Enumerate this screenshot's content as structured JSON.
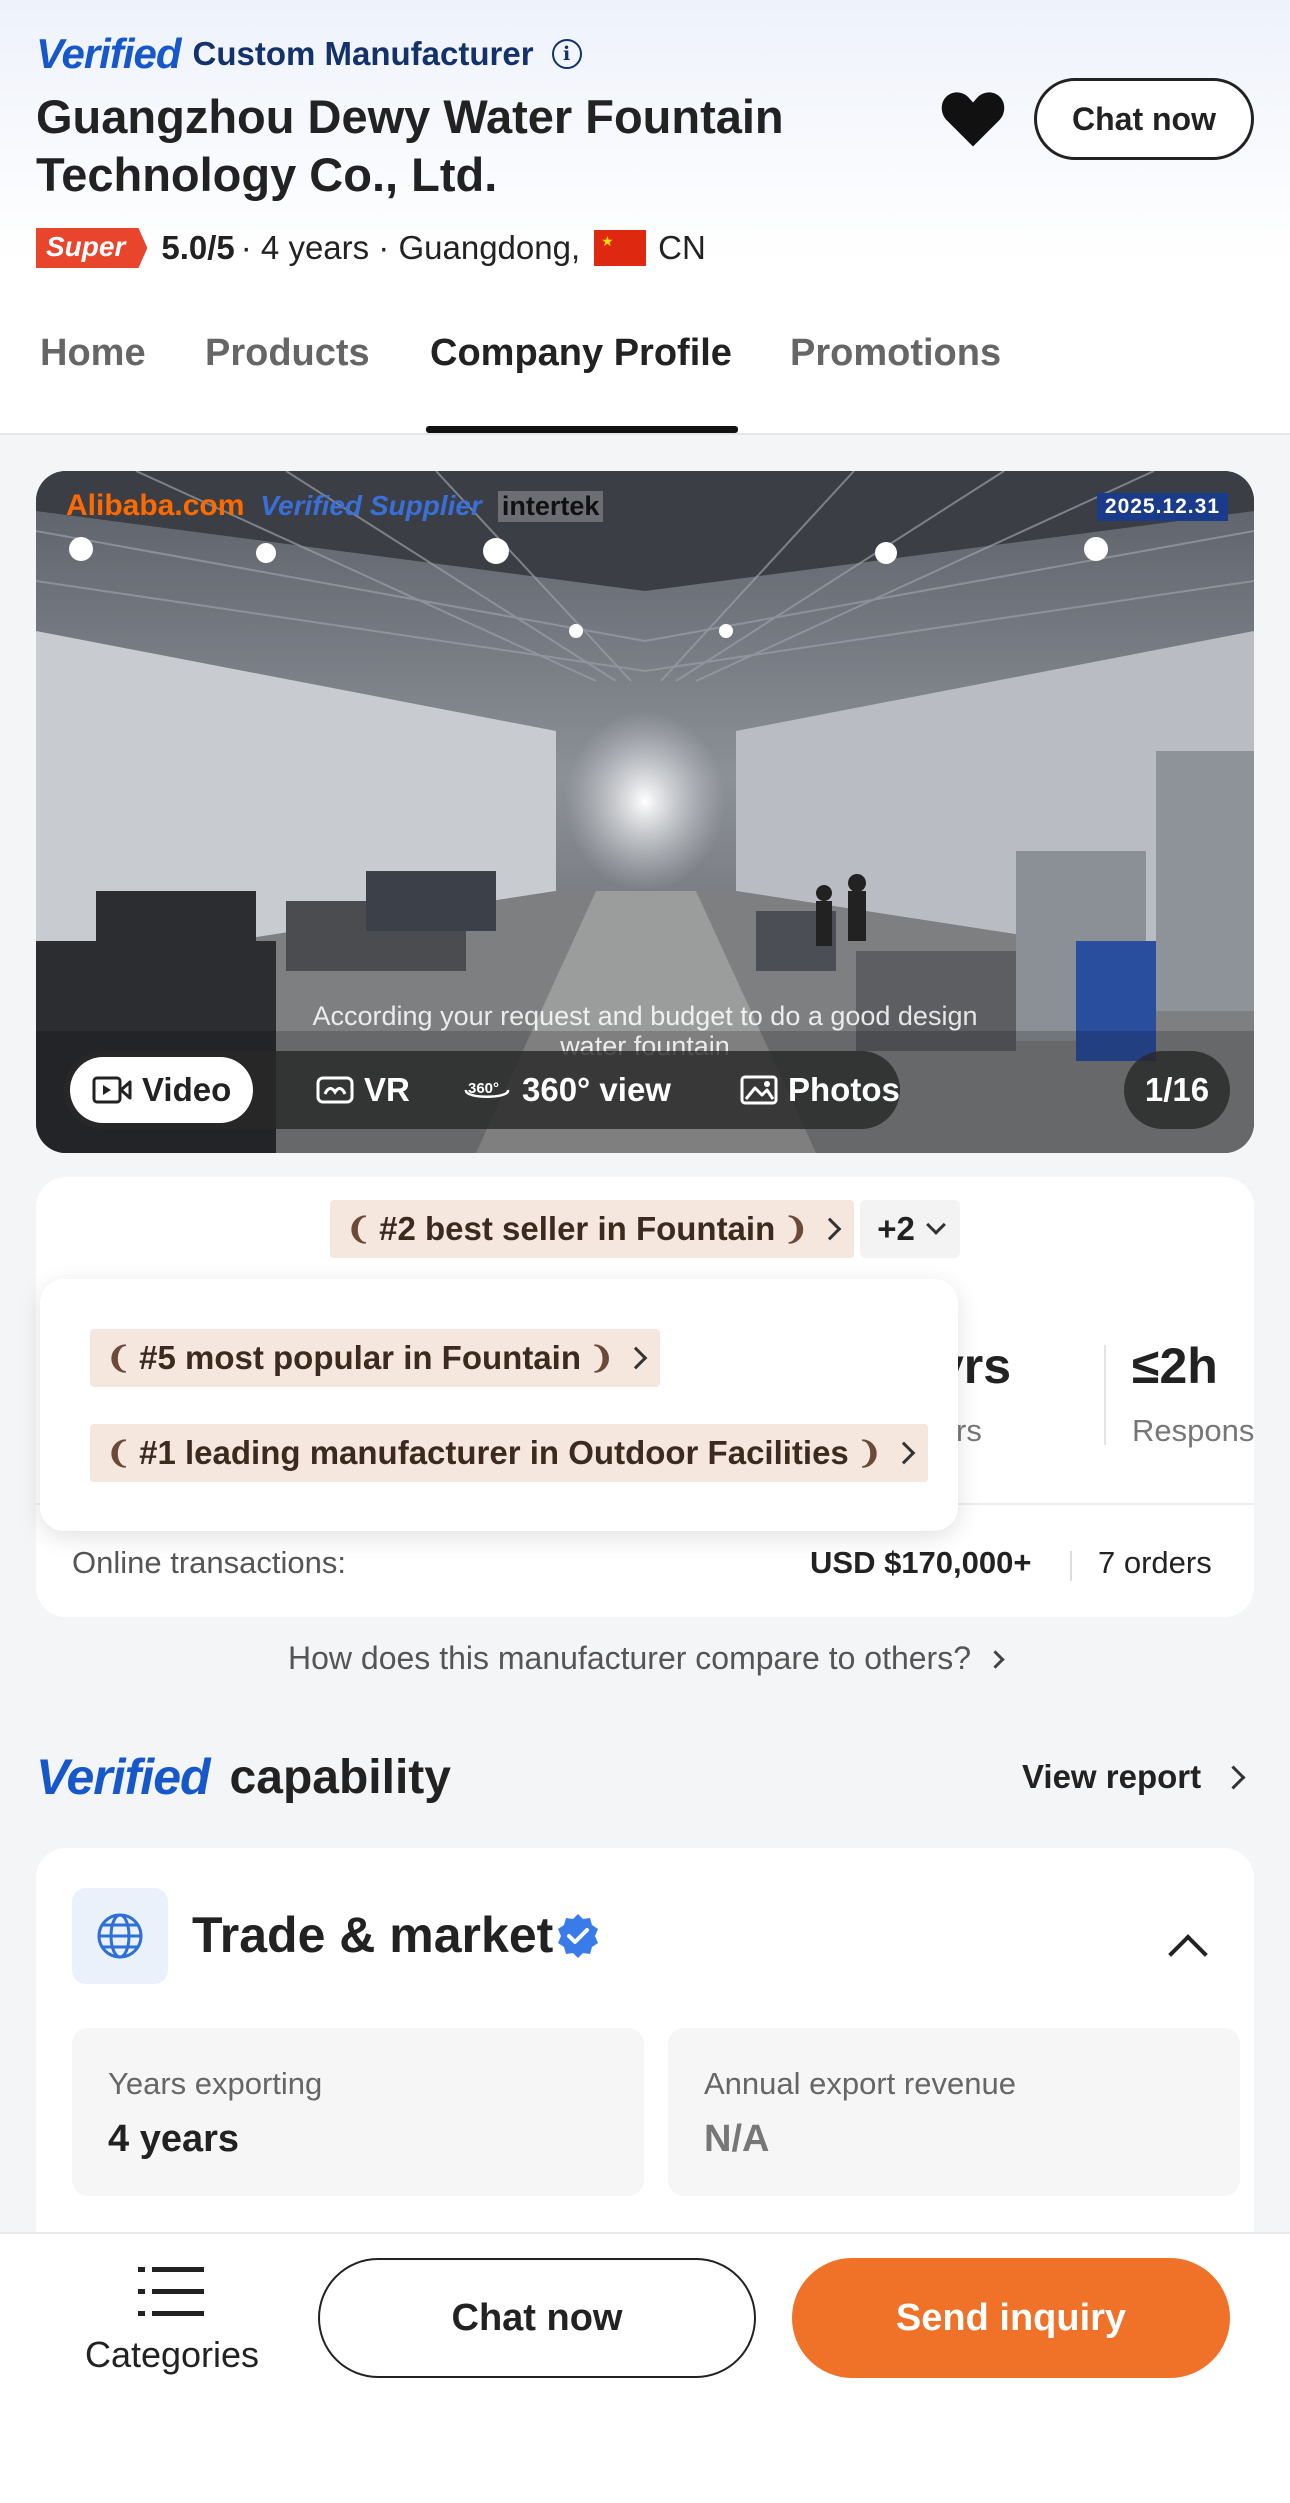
{
  "header": {
    "verified_logo": "Verified",
    "supplier_type": "Custom Manufacturer",
    "company_name": "Guangzhou Dewy Water Fountain Technology Co., Ltd.",
    "chat_button": "Chat now",
    "super_badge": "Super",
    "rating": "5.0/5",
    "meta": "· 4 years · Guangdong,",
    "country": "CN"
  },
  "tabs": [
    {
      "label": "Home"
    },
    {
      "label": "Products"
    },
    {
      "label": "Company Profile",
      "active": true
    },
    {
      "label": "Promotions"
    }
  ],
  "hero": {
    "brand_alibaba": "Alibaba.com",
    "brand_verified": "Verified Supplier",
    "brand_intertek": "intertek",
    "date": "2025.12.31",
    "caption_line1": "According your request and budget to do a good design",
    "caption_line2": "water fountain",
    "media_tabs": [
      {
        "label": "Video",
        "icon": "video-icon",
        "active": true
      },
      {
        "label": "VR",
        "icon": "vr-icon"
      },
      {
        "label": "360° view",
        "icon": "360-icon"
      },
      {
        "label": "Photos",
        "icon": "photos-icon"
      }
    ],
    "counter": "1/16"
  },
  "rankings": {
    "primary": "#2 best seller in Fountain",
    "more": "+2",
    "dropdown": [
      "#5 most popular in Fountain",
      "#1 leading manufacturer in Outdoor Facilities"
    ]
  },
  "stats": [
    {
      "value": "yrs",
      "label": "rs"
    },
    {
      "value": "≤2h",
      "label": "Respons"
    }
  ],
  "transactions": {
    "label": "Online transactions:",
    "value": "USD $170,000+",
    "orders": "7 orders"
  },
  "compare_link": "How does this manufacturer compare to others?",
  "capability": {
    "title_logo": "Verified",
    "title_word": "capability",
    "view_report": "View report",
    "section_title": "Trade & market",
    "metrics": [
      {
        "label": "Years exporting",
        "value": "4 years"
      },
      {
        "label": "Annual export revenue",
        "value": "N/A"
      }
    ]
  },
  "bottom_bar": {
    "categories": "Categories",
    "chat": "Chat now",
    "inquiry": "Send inquiry"
  },
  "colors": {
    "accent_orange": "#ef7228",
    "verified_blue": "#1657c9",
    "super_red": "#e8452c"
  }
}
